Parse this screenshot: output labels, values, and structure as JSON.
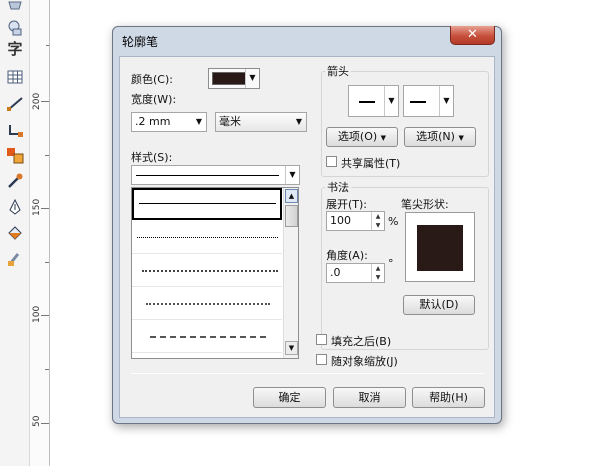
{
  "toolbox": {
    "tools": [
      "shape-tool-icon",
      "text-tool-icon",
      "table-tool-icon",
      "dimension-tool-icon",
      "connector-tool-icon",
      "blend-tool-icon",
      "eyedropper-tool-icon",
      "outline-pen-tool-icon",
      "fill-tool-icon",
      "interactive-fill-tool-icon"
    ]
  },
  "ruler": {
    "labels": [
      "200",
      "150",
      "100",
      "50"
    ]
  },
  "dialog": {
    "title": "轮廓笔",
    "close_glyph": "✕",
    "color_label": "颜色(C):",
    "color_value": "#2a1a17",
    "width_label": "宽度(W):",
    "width_value": ".2 mm",
    "unit_value": "毫米",
    "style_label": "样式(S):",
    "dropdown_glyph": "▼",
    "arrows": {
      "group_label": "箭头",
      "left_options_button": "选项(O)",
      "right_options_button": "选项(N)",
      "share_attributes_label": "共享属性(T)"
    },
    "calligraphy": {
      "group_label": "书法",
      "stretch_label": "展开(T):",
      "stretch_value": "100",
      "stretch_unit": "%",
      "angle_label": "角度(A):",
      "angle_value": ".0",
      "angle_unit": "°",
      "nib_shape_label": "笔尖形状:",
      "default_button": "默认(D)"
    },
    "behind_fill_label": "填充之后(B)",
    "scale_with_object_label": "随对象缩放(J)",
    "ok_button": "确定",
    "cancel_button": "取消",
    "help_button": "帮助(H)"
  }
}
